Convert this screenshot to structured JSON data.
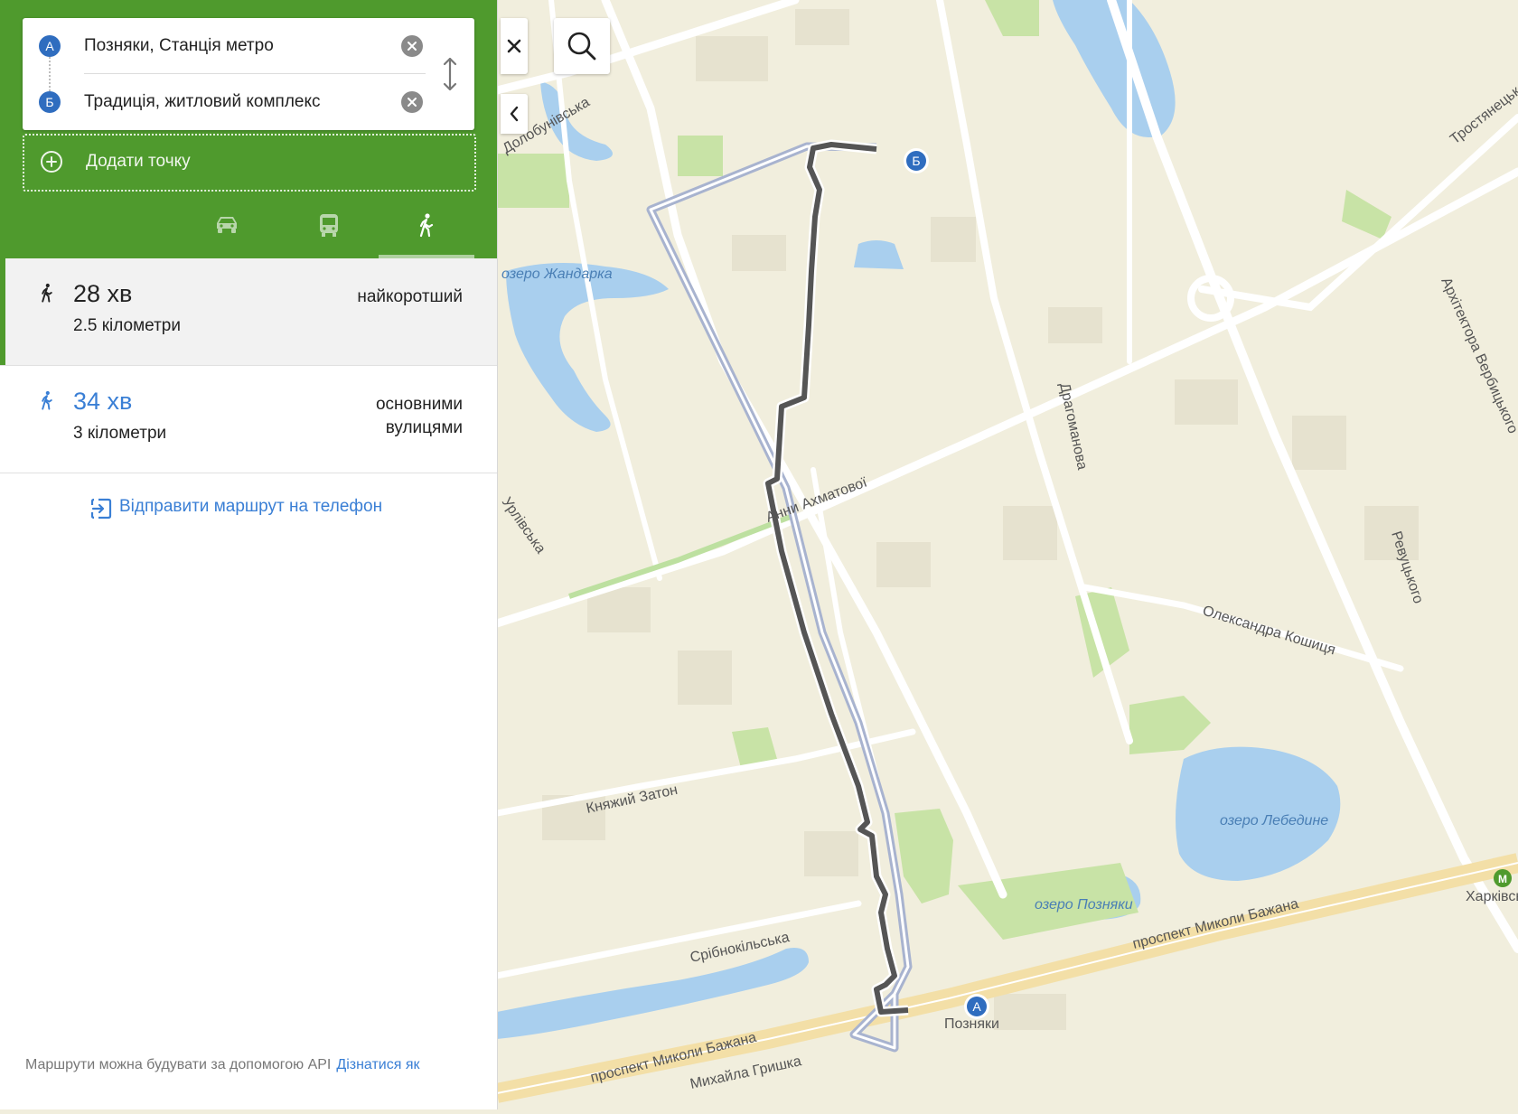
{
  "route": {
    "origin": {
      "marker": "А",
      "name": "Позняки, Станція метро",
      "clear_icon": "close-circle-icon"
    },
    "destination": {
      "marker": "Б",
      "name": "Традиція, житловий комплекс",
      "clear_icon": "close-circle-icon"
    },
    "swap_icon": "swap-vertical-icon",
    "add_point_label": "Додати точку",
    "add_point_icon": "plus-circle-icon"
  },
  "modes": [
    {
      "name": "car",
      "icon": "car-icon"
    },
    {
      "name": "public-transport",
      "icon": "bus-icon"
    },
    {
      "name": "walk",
      "icon": "walk-icon",
      "selected": true
    }
  ],
  "options": [
    {
      "icon": "walk-icon",
      "time": "28 хв",
      "distance": "2.5 кілометри",
      "tag": "найкоротший",
      "selected": true
    },
    {
      "icon": "walk-icon",
      "time": "34 хв",
      "distance": "3 кілометри",
      "tag_line1": "основними",
      "tag_line2": "вулицями",
      "selected": false
    }
  ],
  "send_to_phone": {
    "label": "Відправити маршрут на телефон",
    "icon": "send-to-phone-icon"
  },
  "api_note": {
    "text": "Маршрути можна будувати за допомогою API",
    "link": "Дізнатися як"
  },
  "map_controls": {
    "close_icon": "close-icon",
    "collapse_icon": "chevron-left-icon",
    "search_icon": "search-icon"
  },
  "map": {
    "lakes": [
      "озеро Жандарка",
      "озеро Лебедине",
      "озеро Позняки"
    ],
    "streets": [
      "Анни Ахматової",
      "Драгоманова",
      "Ревуцького",
      "Архітектора Вербицького",
      "Олександра Кошиця",
      "Княжий Затон",
      "Срібнокільська",
      "проспект Миколи Бажана",
      "проспект Миколи Бажана",
      "Михайла Гришка",
      "Урлівська",
      "Долобунівська",
      "Тростянецька"
    ],
    "metro_stations": [
      "Позняки",
      "Харківська"
    ],
    "markers": [
      "А",
      "Б"
    ],
    "colors": {
      "green_header": "#4f9a2d",
      "accent_blue": "#3a7fd5",
      "marker_blue": "#2f6dbf",
      "water": "#a9cfee",
      "park": "#c8e3a6",
      "land": "#f1eedd",
      "road": "#ffffff",
      "route_main": "#555555",
      "route_alt": "#a8b3cf"
    }
  }
}
